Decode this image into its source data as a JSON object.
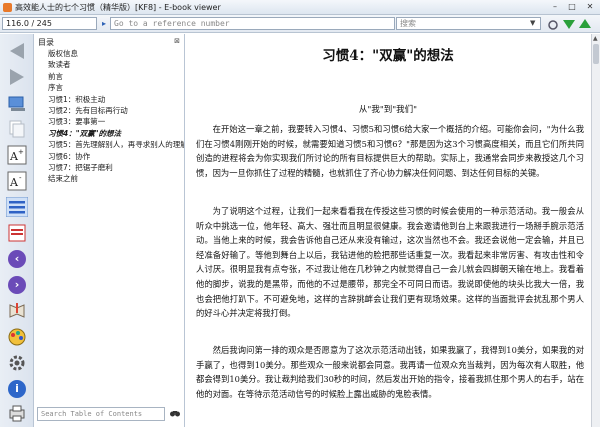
{
  "window": {
    "title": "高效能人士的七个习惯（精华版）[KF8] - E-book viewer",
    "min": "–",
    "max": "□",
    "close": "✕"
  },
  "toolbar": {
    "page_value": "116.0 / 245",
    "reference_placeholder": "Go to a reference number",
    "search_placeholder": "搜索"
  },
  "toc": {
    "heading": "目录",
    "close_label": "⊠",
    "items": [
      "版权信息",
      "致读者",
      "前言",
      "序言",
      "习惯1：积极主动",
      "习惯2：先有目标再行动",
      "习惯3：要事第一",
      "习惯4：\"双赢\"的想法",
      "习惯5：首先理解别人，再寻求别人的理解",
      "习惯6：协作",
      "习惯7：把锯子磨利",
      "结束之前"
    ],
    "selected_index": 7,
    "search_placeholder": "Search Table of Contents"
  },
  "content": {
    "chapter_title": "习惯4：\"双赢\"的想法",
    "section_title": "从\"我\"到\"我们\"",
    "paragraphs": [
      "在开始这一章之前，我要转入习惯4、习惯5和习惯6给大家一个概括的介绍。可能你会问，\"为什么我们在习惯4刚刚开始的时候，就需要知道习惯5和习惯6？\"那是因为这3个习惯高度相关，而且它们所共同创造的进程将会为你实现我们所讨论的所有目标提供巨大的帮助。实际上，我通常会同步来教授这几个习惯，因为一旦你抓住了过程的精髓，也就抓住了齐心协力解决任何问题、到达任何目标的关键。",
      "为了说明这个过程，让我们一起来看看我在传授这些习惯的时候会使用的一种示范活动。我一般会从听众中挑选一位，他年轻、高大、强壮而且明显很健康。我会邀请他到台上来跟我进行一场掰手腕示范活动。当他上来的时候，我会告诉他自己还从来没有输过，这次当然也不会。我还会说他一定会输，并且已经准备好输了。等他到舞台上以后，我钻进他的脸把那些话重复一次。我看起来非常厉害、有攻击性和令人讨厌。很明显我有点夸张，不过我让他在几秒钟之内就觉得自己一会儿就会四脚朝天输在地上。我看着他的脚步，说我的是黑带，而他的不过是腰带，那完全不可同日而语。我说即使他的块头比我大一倍，我也会把他打趴下。不可避免地，这样的言辞挑衅会让我们更有现场效果。这样的当面批评会扰乱那个男人的好斗心并决定将我打倒。",
      "然后我询问第一排的观众是否愿意为了这次示范活动出钱，如果我赢了，我得到10美分，如果我的对手赢了，也得到10美分。那些观众一般来说都会同意。我再请一位观众充当裁判，因为每次有人取胜，他都会得到10美分。我让裁判给我们30秒的时间，然后发出开始的指令，接着我抓住那个男人的右手，站在他的对面。在等待示范活动信号的时候脸上露出威胁的鬼脸表情。"
    ]
  }
}
